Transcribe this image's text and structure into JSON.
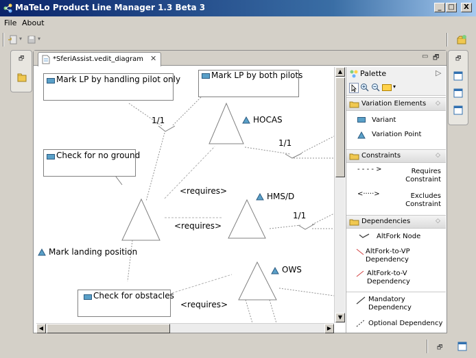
{
  "window": {
    "title": "MaTeLo Product Line Manager 1.3 Beta 3",
    "buttons": [
      "_",
      "□",
      "X"
    ]
  },
  "menu": [
    "File",
    "About"
  ],
  "editor": {
    "tab_label": "*SferiAssist.vedit_diagram",
    "tab_close": "✕"
  },
  "diagram": {
    "variants": [
      "Mark LP by handling pilot only",
      "Mark LP by both pilots",
      "Check for no ground",
      "Check for obstacles"
    ],
    "variation_points": [
      "HOCAS",
      "HMS/D",
      "OWS",
      "Mark landing position"
    ],
    "fork_labels": [
      "1/1",
      "1/1",
      "1/1"
    ],
    "requires_labels": [
      "<requires>",
      "<requires>",
      "<requires>"
    ]
  },
  "palette": {
    "title": "Palette",
    "drawers": [
      {
        "label": "Variation Elements",
        "entries": [
          "Variant",
          "Variation Point"
        ]
      },
      {
        "label": "Constraints",
        "entries": [
          "Requires Constraint",
          "Excludes Constraint"
        ]
      },
      {
        "label": "Dependencies",
        "entries": [
          "AltFork Node",
          "AltFork-to-VP Dependency",
          "AltFork-to-V Dependency",
          "Mandatory Dependency",
          "Optional Dependency"
        ]
      }
    ]
  },
  "colors": {
    "variant_icon": "#5aa0c8",
    "vp_icon": "#5aa0c8",
    "title_bar": "#0a246a",
    "folder_icon": "#f0c850"
  }
}
